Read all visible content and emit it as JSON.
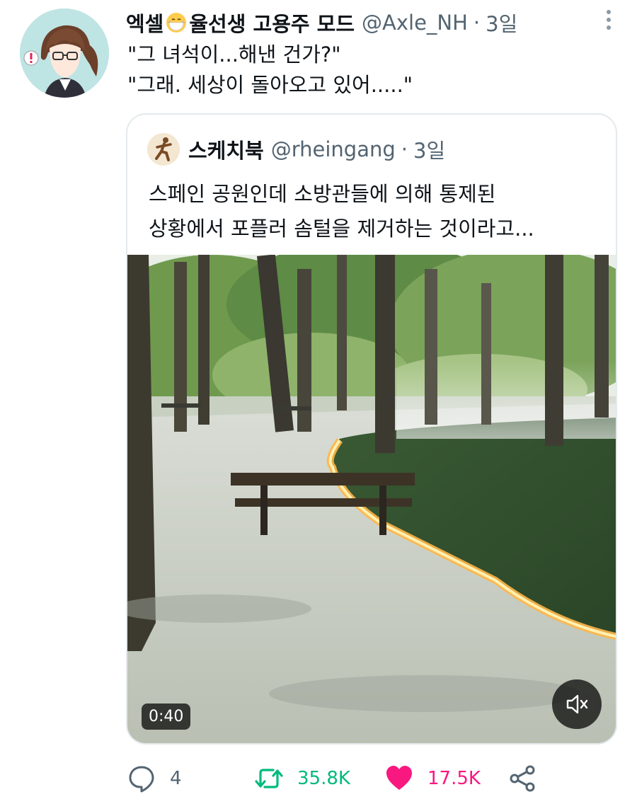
{
  "tweet": {
    "display_name_part1": "엑셀",
    "display_name_part2": "율선생 고용주 모드",
    "handle": "@Axle_NH",
    "separator": "·",
    "time": "3일",
    "text_lines": [
      "\"그 녀석이...해낸 건가?\"",
      "\"그래. 세상이 돌아오고 있어.....\""
    ]
  },
  "quote": {
    "display_name": "스케치북",
    "handle": "@rheingang",
    "separator": "·",
    "time": "3일",
    "text_lines": [
      "스페인 공원인데 소방관들에 의해 통제된",
      "상황에서 포플러 솜털을 제거하는 것이라고..."
    ],
    "video": {
      "duration": "0:40",
      "mute_icon": "speaker-muted-icon"
    }
  },
  "actions": {
    "reply_count": "4",
    "retweet_count": "35.8K",
    "like_count": "17.5K"
  },
  "colors": {
    "text_primary": "#0f1419",
    "text_secondary": "#536471",
    "retweet": "#00ba7c",
    "like": "#f91880",
    "card_border": "#e4e9ec"
  }
}
